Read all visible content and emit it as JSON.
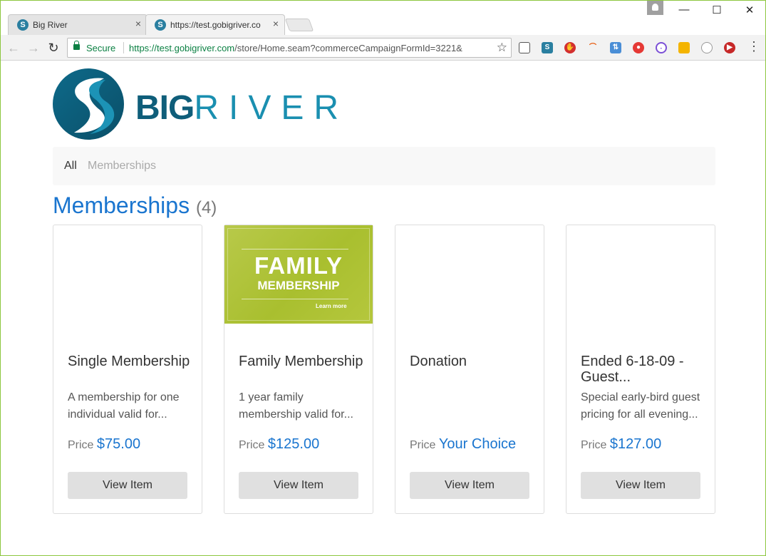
{
  "browser": {
    "tabs": [
      {
        "title": "Big River",
        "close": "×"
      },
      {
        "title": "https://test.gobigriver.co",
        "close": "×"
      }
    ],
    "window_controls": {
      "minimize": "—",
      "maximize": "☐",
      "close": "✕"
    },
    "address_bar": {
      "secure_label": "Secure",
      "url_host": "https://test.gobigriver.com",
      "url_path": "/store/Home.seam?commerceCampaignFormId=3221&"
    }
  },
  "site": {
    "logo": {
      "big": "BIG",
      "river": "RIVER"
    },
    "nav": {
      "all": "All",
      "memberships": "Memberships"
    },
    "heading": {
      "title": "Memberships",
      "count": "(4)"
    }
  },
  "cards": [
    {
      "title": "Single Membership",
      "desc": "A membership for one individual valid for...",
      "price_label": "Price",
      "price": "$75.00",
      "button": "View Item"
    },
    {
      "title": "Family Membership",
      "desc": "1 year family membership valid for...",
      "price_label": "Price",
      "price": "$125.00",
      "button": "View Item",
      "image": {
        "line1": "FAMILY",
        "line2": "MEMBERSHIP",
        "learn": "Learn more"
      }
    },
    {
      "title": "Donation",
      "desc": "",
      "price_label": "Price",
      "price": "Your Choice",
      "button": "View Item"
    },
    {
      "title": "Ended 6-18-09 - Guest...",
      "desc": "Special early-bird guest pricing for all evening...",
      "price_label": "Price",
      "price": "$127.00",
      "button": "View Item"
    }
  ],
  "colors": {
    "accent": "#1a75cf",
    "brand": "#0f5e7a",
    "secure": "#0b8043",
    "window_border": "#8cc63f"
  }
}
